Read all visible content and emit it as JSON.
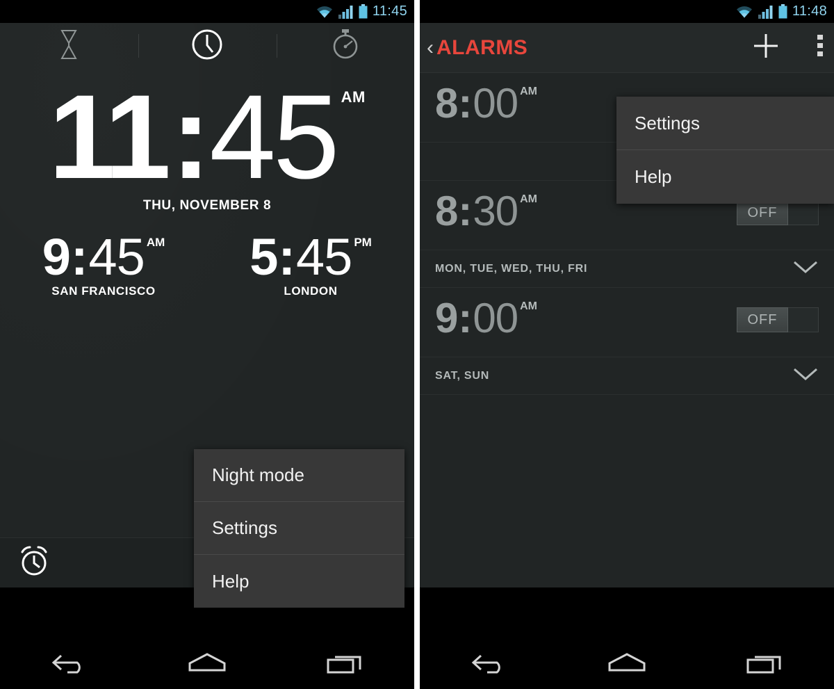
{
  "left_phone": {
    "status_bar": {
      "time": "11:45",
      "icons": [
        "wifi-icon",
        "signal-icon",
        "battery-icon"
      ]
    },
    "tabs": [
      {
        "name": "timer",
        "icon": "hourglass-icon"
      },
      {
        "name": "clock",
        "icon": "clock-icon",
        "selected": true
      },
      {
        "name": "stopwatch",
        "icon": "stopwatch-icon"
      }
    ],
    "main_clock": {
      "hours": "11",
      "colon": ":",
      "minutes": "45",
      "ampm": "AM",
      "date": "THU, NOVEMBER 8"
    },
    "world_clocks": [
      {
        "hours": "9",
        "colon": ":",
        "minutes": "45",
        "ampm": "AM",
        "city": "SAN FRANCISCO"
      },
      {
        "hours": "5",
        "colon": ":",
        "minutes": "45",
        "ampm": "PM",
        "city": "LONDON"
      }
    ],
    "overflow_menu": {
      "items": [
        "Night mode",
        "Settings",
        "Help"
      ]
    },
    "toolbar": [
      {
        "name": "alarm-button",
        "icon": "alarm-clock-icon"
      },
      {
        "name": "cities-button",
        "icon": "location-pin-icon"
      },
      {
        "name": "overflow-button",
        "icon": "overflow-menu-icon"
      }
    ]
  },
  "right_phone": {
    "status_bar": {
      "time": "11:48",
      "icons": [
        "wifi-icon",
        "signal-icon",
        "battery-icon"
      ]
    },
    "action_bar": {
      "back": "‹",
      "title": "ALARMS",
      "add_label": "+",
      "overflow": "overflow-menu-icon"
    },
    "alarms": [
      {
        "hours": "8",
        "colon": ":",
        "minutes": "00",
        "ampm": "AM",
        "toggle": "",
        "days": null
      },
      {
        "hours": "8",
        "colon": ":",
        "minutes": "30",
        "ampm": "AM",
        "toggle": "OFF",
        "days": "MON, TUE, WED, THU, FRI"
      },
      {
        "hours": "9",
        "colon": ":",
        "minutes": "00",
        "ampm": "AM",
        "toggle": "OFF",
        "days": "SAT, SUN"
      }
    ],
    "overflow_menu": {
      "items": [
        "Settings",
        "Help"
      ]
    }
  },
  "nav_bar": {
    "buttons": [
      "back-icon",
      "home-icon",
      "recents-icon"
    ]
  },
  "colors": {
    "accent_red": "#e8463c",
    "status_blue": "#8fd3ee",
    "screen_bg": "#212525",
    "menu_bg": "#383838"
  }
}
